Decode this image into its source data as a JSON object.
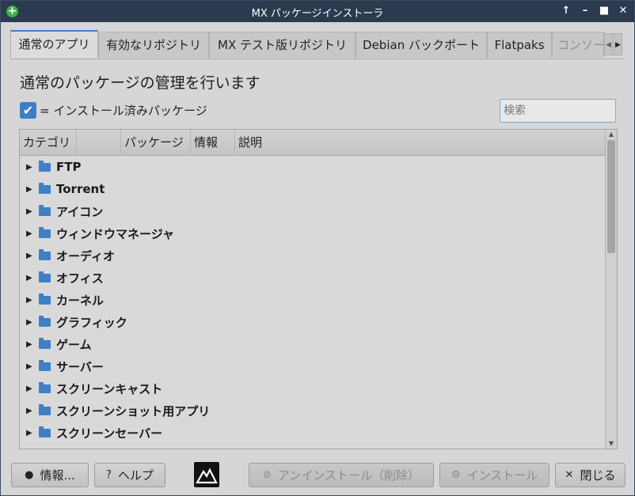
{
  "window": {
    "title": "MX パッケージインストーラ"
  },
  "tabs": [
    {
      "label": "通常のアプリ"
    },
    {
      "label": "有効なリポジトリ"
    },
    {
      "label": "MX テスト版リポジトリ"
    },
    {
      "label": "Debian バックポート"
    },
    {
      "label": "Flatpaks"
    },
    {
      "label": "コンソール"
    }
  ],
  "heading": "通常のパッケージの管理を行います",
  "legend": {
    "check_mark": "✔",
    "text": "= インストール済みパッケージ"
  },
  "search": {
    "placeholder": "検索"
  },
  "tree": {
    "columns": [
      "カテゴリ",
      "",
      "パッケージ",
      "情報",
      "説明"
    ],
    "rows": [
      "FTP",
      "Torrent",
      "アイコン",
      "ウィンドウマネージャ",
      "オーディオ",
      "オフィス",
      "カーネル",
      "グラフィック",
      "ゲーム",
      "サーバー",
      "スクリーンキャスト",
      "スクリーンショット用アプリ",
      "スクリーンセーバー"
    ]
  },
  "buttons": {
    "info": "情報...",
    "help": "ヘルプ",
    "uninstall": "アンインストール（削除）",
    "install": "インストール",
    "close": "閉じる"
  },
  "colors": {
    "titlebar": "#2b3a4f",
    "accent": "#3e82cc",
    "window_bg": "#d6d6d6"
  }
}
